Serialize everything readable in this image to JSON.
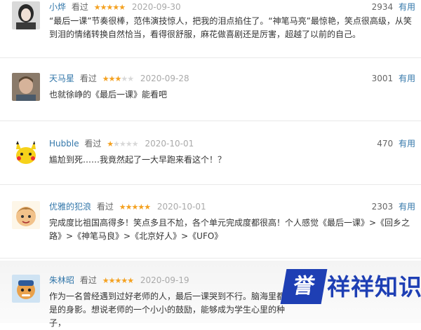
{
  "reviews": [
    {
      "user": "小烨",
      "status": "看过",
      "rating": 5,
      "date": "2020-09-30",
      "votes": "2934",
      "useful_label": "有用",
      "content": "“最后一课”节奏很棒，范伟演技惊人，把我的泪点掐住了。“神笔马亮”最惊艳，笑点很高级，从笑到泪的情绪转换自然恰当，看得很舒服，麻花做喜剧还是厉害，超越了以前的自己。"
    },
    {
      "user": "天马星",
      "status": "看过",
      "rating": 3,
      "date": "2020-09-28",
      "votes": "3001",
      "useful_label": "有用",
      "content": "也就徐峥的《最后一课》能看吧"
    },
    {
      "user": "Hubble",
      "status": "看过",
      "rating": 1,
      "date": "2020-10-01",
      "votes": "470",
      "useful_label": "有用",
      "content": "尴尬到死……我竟然起了一大早跑来看这个！？"
    },
    {
      "user": "优雅的犯浪",
      "status": "看过",
      "rating": 5,
      "date": "2020-10-01",
      "votes": "2303",
      "useful_label": "有用",
      "content": "完成度比祖国高得多！笑点多且不尬，各个单元完成度都很高！个人感觉《最后一课》>《回乡之路》>《神笔马良》>《北京好人》>《UFO》"
    },
    {
      "user": "朱林昭",
      "status": "看过",
      "rating": 5,
      "date": "2020-09-19",
      "votes": "",
      "useful_label": "",
      "content": "作为一名曾经遇到过好老师的人，最后一课哭到不行。脑海里都是的身影。想说老师的一个小小的鼓励，能够成为学生心里的种子，"
    }
  ],
  "watermark": {
    "badge": "誉",
    "text": "祥祥知识"
  },
  "colors": {
    "link": "#3377aa",
    "star": "#f4a120",
    "star_off": "#d8d8d8",
    "watermark": "#1e3fb4"
  }
}
